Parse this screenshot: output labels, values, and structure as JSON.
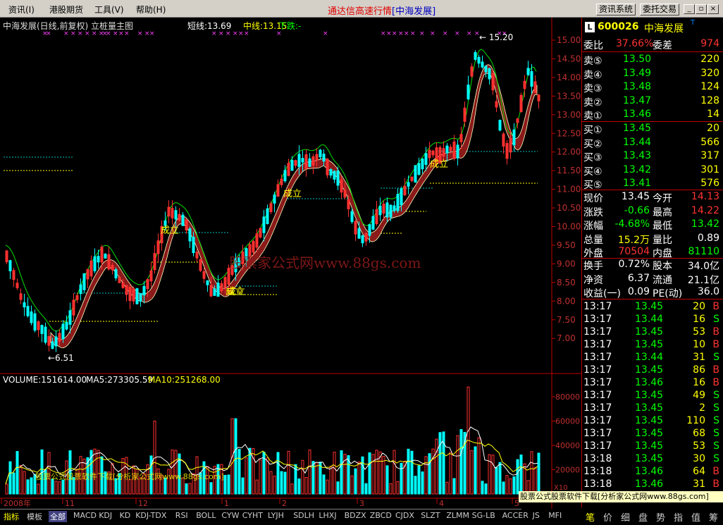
{
  "menu": {
    "items": [
      "资讯(I)",
      "港股期货",
      "工具(V)",
      "帮助(H)"
    ],
    "title": "通达信高速行情",
    "title_stock": "[中海发展]",
    "btn_info": "资讯系统",
    "btn_trade": "委托交易"
  },
  "chart": {
    "header": "中海发展(日线,前复权) 立桩量主图",
    "short_label": "短线:13.69",
    "mid_label": "中线:13.15",
    "trend_label": "下跌:-",
    "y_labels": [
      "15.00",
      "14.50",
      "14.00",
      "13.50",
      "13.00",
      "12.50",
      "12.00",
      "11.50",
      "11.00",
      "10.50",
      "10.00",
      "9.50",
      "9.00",
      "8.50",
      "8.00",
      "7.50",
      "7.00"
    ],
    "high_marker": "15.20",
    "low_marker": "6.51",
    "signals": [
      "成立",
      "成立",
      "成立",
      "成立",
      "成立"
    ],
    "watermark": "股票家公式网www.88gs.com",
    "volume_header": "VOLUME:151614.00",
    "ma5": "MA5:273305.59",
    "ma10": "MA10:251268.00",
    "vol_labels": [
      "80000",
      "60000",
      "40000",
      "20000"
    ],
    "vol_unit": "X10",
    "x_labels": [
      "2008年",
      "11",
      "12",
      "1",
      "2",
      "3",
      "4",
      "5"
    ],
    "vol_watermark": "股票公式股票软件下载[分析家公式网www.88gs.com]"
  },
  "indicator_tabs": [
    "指标",
    "模板",
    "全部",
    "MACD",
    "KDJ",
    "KD",
    "KDJ-TDX",
    "RSI",
    "BOLL",
    "CYW",
    "CYHT",
    "LYJH",
    "SDLH",
    "LHXJ",
    "BDZX",
    "ZBCD",
    "CJDX",
    "SLZT",
    "ZLMM",
    "SG-LB",
    "ACCER",
    "JS",
    "MFI"
  ],
  "quote": {
    "code": "600026",
    "name": "中海发展",
    "wb_label": "委比",
    "wb": "37.66%",
    "wc_label": "委差",
    "wc": "974",
    "sells": [
      {
        "l": "卖⑤",
        "p": "13.50",
        "v": "220"
      },
      {
        "l": "卖④",
        "p": "13.49",
        "v": "320"
      },
      {
        "l": "卖③",
        "p": "13.48",
        "v": "124"
      },
      {
        "l": "卖②",
        "p": "13.47",
        "v": "128"
      },
      {
        "l": "卖①",
        "p": "13.46",
        "v": "14"
      }
    ],
    "buys": [
      {
        "l": "买①",
        "p": "13.45",
        "v": "20"
      },
      {
        "l": "买②",
        "p": "13.44",
        "v": "566"
      },
      {
        "l": "买③",
        "p": "13.43",
        "v": "317"
      },
      {
        "l": "买④",
        "p": "13.42",
        "v": "301"
      },
      {
        "l": "买⑤",
        "p": "13.41",
        "v": "576"
      }
    ],
    "stats": [
      {
        "a": "现价",
        "b": "13.45",
        "c": "今开",
        "d": "14.13"
      },
      {
        "a": "涨跌",
        "b": "-0.66",
        "c": "最高",
        "d": "14.22"
      },
      {
        "a": "涨幅",
        "b": "-4.68%",
        "c": "最低",
        "d": "13.42"
      },
      {
        "a": "总量",
        "b": "15.2万",
        "c": "量比",
        "d": "0.89"
      },
      {
        "a": "外盘",
        "b": "70504",
        "c": "内盘",
        "d": "81110"
      }
    ],
    "stats2": [
      {
        "a": "换手",
        "b": "0.72%",
        "c": "股本",
        "d": "34.0亿"
      },
      {
        "a": "净资",
        "b": "6.37",
        "c": "流通",
        "d": "21.1亿"
      },
      {
        "a": "收益(一)",
        "b": "0.09",
        "c": "PE(动)",
        "d": "36.0"
      }
    ],
    "ticks": [
      [
        "13:17",
        "13.45",
        "20",
        "B"
      ],
      [
        "13:17",
        "13.44",
        "16",
        "S"
      ],
      [
        "13:17",
        "13.45",
        "53",
        "B"
      ],
      [
        "13:17",
        "13.45",
        "10",
        "B"
      ],
      [
        "13:17",
        "13.44",
        "31",
        "S"
      ],
      [
        "13:17",
        "13.45",
        "86",
        "B"
      ],
      [
        "13:17",
        "13.46",
        "16",
        "B"
      ],
      [
        "13:17",
        "13.45",
        "49",
        "S"
      ],
      [
        "13:17",
        "13.45",
        "2",
        "S"
      ],
      [
        "13:17",
        "13.45",
        "110",
        "S"
      ],
      [
        "13:17",
        "13.45",
        "68",
        "S"
      ],
      [
        "13:17",
        "13.45",
        "53",
        "S"
      ],
      [
        "13:18",
        "13.45",
        "30",
        "S"
      ],
      [
        "13:18",
        "13.46",
        "64",
        "B"
      ],
      [
        "13:18",
        "13.46",
        "31",
        "B"
      ]
    ],
    "footer_ad": "股票公式股票软件下载[分析家公式网www.88gs.com]",
    "tabs": [
      "笔",
      "价",
      "细",
      "盘",
      "势",
      "指",
      "值",
      "筹"
    ]
  }
}
